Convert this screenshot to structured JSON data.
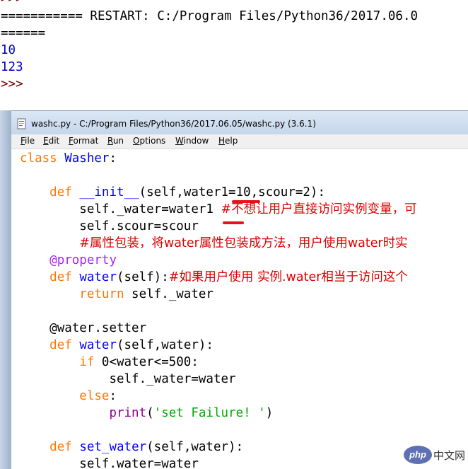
{
  "shell": {
    "top_partial": ">>>",
    "restart_line": "=========== RESTART: C:/Program Files/Python36/2017.06.0",
    "restart_tail": "======",
    "output1": "10",
    "output2": "123",
    "prompt": ">>>"
  },
  "window": {
    "title": "washc.py - C:/Program Files/Python36/2017.06.05/washc.py (3.6.1)",
    "menus": [
      {
        "key": "F",
        "rest": "ile"
      },
      {
        "key": "E",
        "rest": "dit"
      },
      {
        "key": "F",
        "rest": "ormat"
      },
      {
        "key": "R",
        "rest": "un"
      },
      {
        "key": "O",
        "rest": "ptions"
      },
      {
        "key": "W",
        "rest": "indow"
      },
      {
        "key": "H",
        "rest": "elp"
      }
    ]
  },
  "code": {
    "l1": {
      "kw": "class",
      "name": "Washer",
      "rest": ":"
    },
    "l3": {
      "kw": "def",
      "name": "__init__",
      "rest": "(self,water1=10,scour=2):"
    },
    "l4": {
      "code": "self._water=water1",
      "comment": "#不想让用户直接访问实例变量，可"
    },
    "l5": {
      "code": "self.scour=scour"
    },
    "l6": {
      "comment": "#属性包装，将water属性包装成方法，用户使用water时实"
    },
    "l7": {
      "code": "@property"
    },
    "l8": {
      "kw": "def",
      "name": "water",
      "rest": "(self):",
      "comment": "#如果用户使用 实例.water相当于访问这个"
    },
    "l9": {
      "kw": "return",
      "rest": " self._water"
    },
    "l11": {
      "code": "@water.setter"
    },
    "l12": {
      "kw": "def",
      "name": "water",
      "rest": "(self,water):"
    },
    "l13": {
      "kw": "if",
      "rest": " 0<water<=500:"
    },
    "l14": {
      "code": "self._water=water"
    },
    "l15": {
      "kw": "else",
      "rest": ":"
    },
    "l16": {
      "builtin": "print",
      "open": "(",
      "string": "'set Failure! '",
      "close": ")"
    },
    "l18": {
      "kw": "def",
      "name": "set_water",
      "rest": "(self,water):"
    },
    "l19": {
      "code": "self.water=water"
    }
  },
  "watermark": {
    "badge": "php",
    "text": "中文网"
  },
  "colors": {
    "keyword": "#ff7700",
    "definition": "#0000ff",
    "builtin": "#900090",
    "comment": "#dd0000",
    "string": "#00aa00",
    "shell_output": "#0000c8",
    "annotation_mark": "#e8121b"
  }
}
